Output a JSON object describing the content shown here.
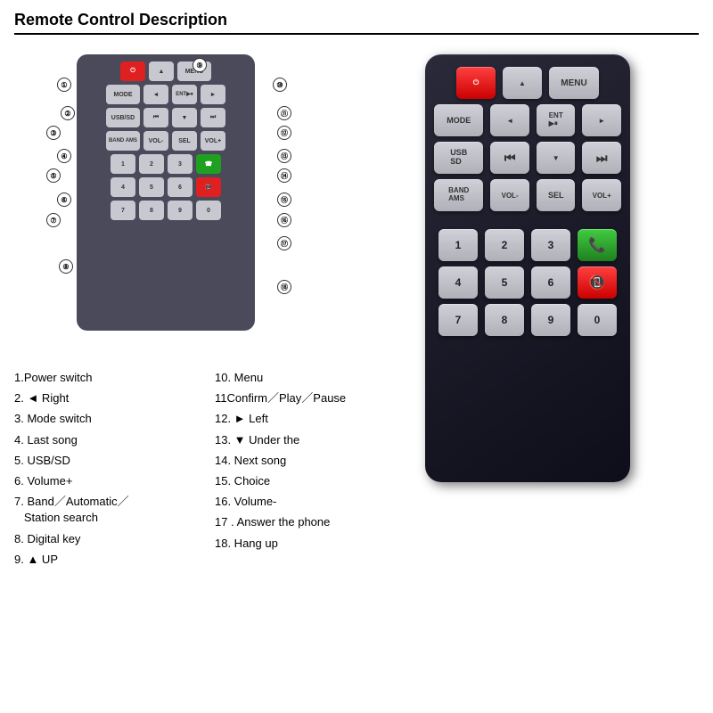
{
  "title": "Remote Control Description",
  "descriptions_left": [
    {
      "num": "1",
      "text": "Power switch"
    },
    {
      "num": "2",
      "text": "◄ Right"
    },
    {
      "num": "3",
      "text": "Mode switch"
    },
    {
      "num": "4",
      "text": "Last song"
    },
    {
      "num": "5",
      "text": "USB/SD"
    },
    {
      "num": "6",
      "text": "Volume+"
    },
    {
      "num": "7",
      "text": "Band／Automatic／Station search"
    },
    {
      "num": "8",
      "text": "Digital key"
    },
    {
      "num": "9",
      "text": "▲ UP"
    }
  ],
  "descriptions_right": [
    {
      "num": "10",
      "text": "Menu"
    },
    {
      "num": "11",
      "text": "Confirm／Play／Pause"
    },
    {
      "num": "12",
      "text": "► Left"
    },
    {
      "num": "13",
      "text": "▼ Under the"
    },
    {
      "num": "14",
      "text": "Next song"
    },
    {
      "num": "15",
      "text": "Choice"
    },
    {
      "num": "16",
      "text": "Volume-"
    },
    {
      "num": "17",
      "text": "Answer the phone"
    },
    {
      "num": "18",
      "text": "Hang up"
    }
  ],
  "remote_rows": [
    {
      "buttons": [
        {
          "label": "⏻",
          "type": "red",
          "desc": "power"
        },
        {
          "label": "▲",
          "type": "normal",
          "desc": "up"
        },
        {
          "label": "MENU",
          "type": "normal",
          "desc": "menu"
        }
      ]
    },
    {
      "buttons": [
        {
          "label": "MODE",
          "type": "normal",
          "desc": "mode"
        },
        {
          "label": "◄",
          "type": "normal",
          "desc": "left-arrow"
        },
        {
          "label": "ENT\n▶⏸",
          "type": "normal",
          "desc": "ent-play-pause"
        },
        {
          "label": "►",
          "type": "normal",
          "desc": "right-arrow"
        }
      ]
    },
    {
      "buttons": [
        {
          "label": "USB\nSD",
          "type": "normal",
          "desc": "usb-sd"
        },
        {
          "label": "⏮",
          "type": "normal",
          "desc": "prev"
        },
        {
          "label": "▼",
          "type": "normal",
          "desc": "down"
        },
        {
          "label": "⏭",
          "type": "normal",
          "desc": "next"
        }
      ]
    },
    {
      "buttons": [
        {
          "label": "BAND\nAMS",
          "type": "normal",
          "desc": "band-ams"
        },
        {
          "label": "VOL-",
          "type": "normal",
          "desc": "vol-minus"
        },
        {
          "label": "SEL",
          "type": "normal",
          "desc": "sel"
        },
        {
          "label": "VOL+",
          "type": "normal",
          "desc": "vol-plus"
        }
      ]
    },
    {
      "buttons": [
        {
          "label": "1",
          "type": "num",
          "desc": "num-1"
        },
        {
          "label": "2",
          "type": "num",
          "desc": "num-2"
        },
        {
          "label": "3",
          "type": "num",
          "desc": "num-3"
        },
        {
          "label": "📞",
          "type": "green",
          "desc": "answer"
        }
      ]
    },
    {
      "buttons": [
        {
          "label": "4",
          "type": "num",
          "desc": "num-4"
        },
        {
          "label": "5",
          "type": "num",
          "desc": "num-5"
        },
        {
          "label": "6",
          "type": "num",
          "desc": "num-6"
        },
        {
          "label": "📵",
          "type": "red-end",
          "desc": "hangup"
        }
      ]
    },
    {
      "buttons": [
        {
          "label": "7",
          "type": "num",
          "desc": "num-7"
        },
        {
          "label": "8",
          "type": "num",
          "desc": "num-8"
        },
        {
          "label": "9",
          "type": "num",
          "desc": "num-9"
        },
        {
          "label": "0",
          "type": "num",
          "desc": "num-0"
        }
      ]
    }
  ]
}
